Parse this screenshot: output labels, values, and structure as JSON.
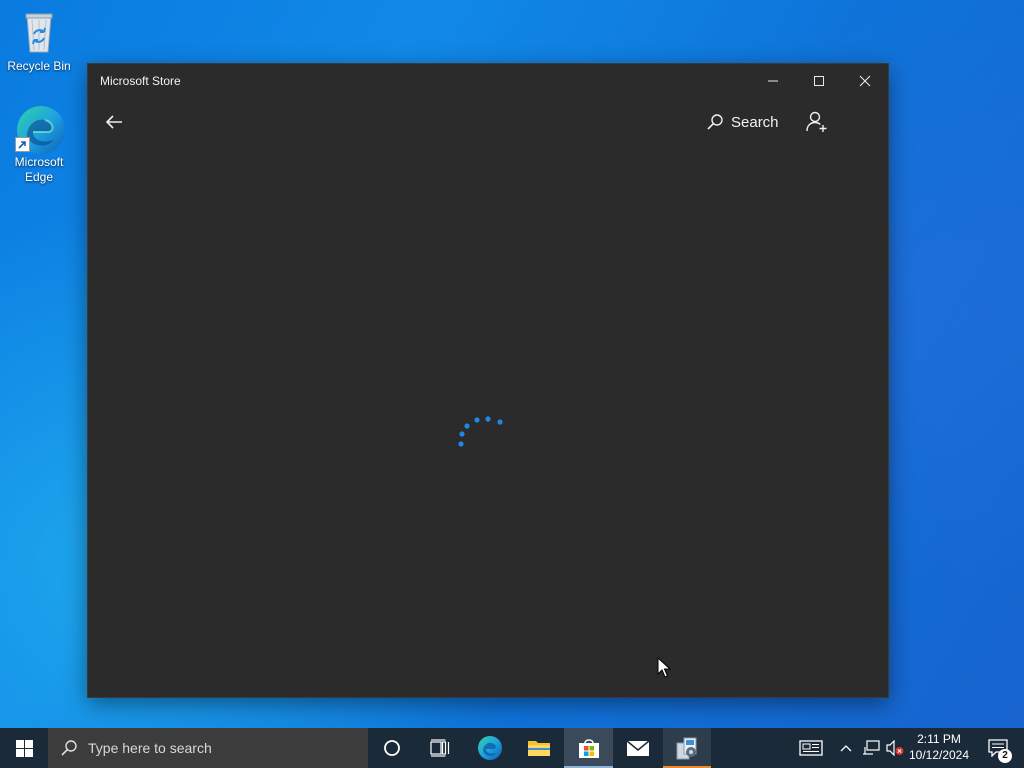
{
  "desktop": {
    "icons": [
      {
        "label": "Recycle Bin",
        "icon": "recycle-bin-icon"
      },
      {
        "label": "Microsoft Edge",
        "icon": "edge-icon"
      }
    ]
  },
  "store_window": {
    "title": "Microsoft Store",
    "controls": {
      "minimize": "minimize-icon",
      "maximize": "maximize-icon",
      "close": "close-icon"
    },
    "appbar": {
      "back": "back-arrow-icon",
      "search_label": "Search",
      "account": "add-account-icon"
    },
    "content": {
      "state": "loading",
      "spinner_color": "#1e88e5"
    }
  },
  "taskbar": {
    "search_placeholder": "Type here to search",
    "pinned": [
      {
        "name": "cortana",
        "icon": "cortana-circle-icon"
      },
      {
        "name": "task-view",
        "icon": "task-view-icon"
      },
      {
        "name": "edge",
        "icon": "edge-icon"
      },
      {
        "name": "file-explorer",
        "icon": "folder-icon"
      },
      {
        "name": "microsoft-store",
        "icon": "store-bag-icon",
        "active": true
      },
      {
        "name": "mail",
        "icon": "mail-icon"
      },
      {
        "name": "installer",
        "icon": "installer-icon",
        "running": true
      }
    ],
    "tray": {
      "time": "2:11 PM",
      "date": "10/12/2024",
      "notifications_count": "2"
    }
  },
  "colors": {
    "taskbar": "#1b2a38",
    "window": "#2b2b2b",
    "accent": "#1e88e5"
  }
}
